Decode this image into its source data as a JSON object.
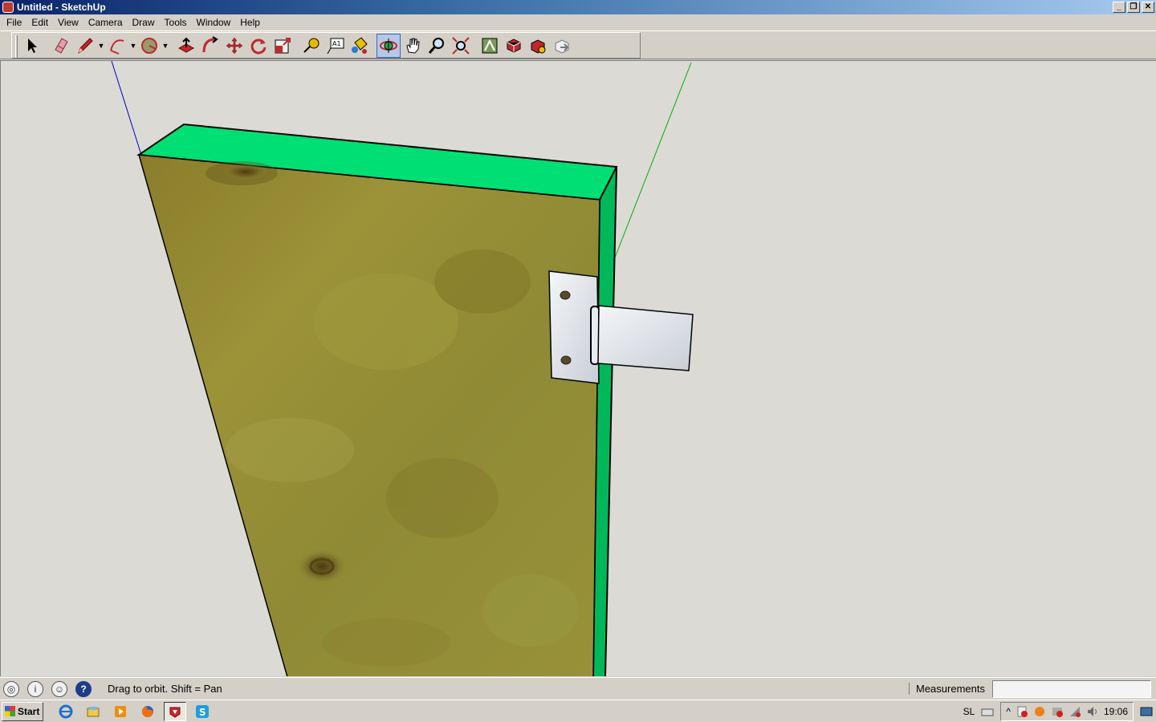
{
  "window": {
    "title": "Untitled - SketchUp",
    "minimize": "_",
    "restore": "❐",
    "close": "✕"
  },
  "menu": [
    "File",
    "Edit",
    "View",
    "Camera",
    "Draw",
    "Tools",
    "Window",
    "Help"
  ],
  "toolbar": {
    "tools": [
      "select",
      "eraser",
      "pencil",
      "arc",
      "circle",
      "push-pull",
      "follow-me",
      "move",
      "rotate",
      "scale",
      "tape-measure",
      "text",
      "paint-bucket",
      "orbit",
      "pan",
      "zoom",
      "zoom-extents",
      "previous-view",
      "outliner",
      "get-models",
      "share-model"
    ],
    "active_tool": "orbit",
    "text_tool_label": "A1"
  },
  "colors": {
    "face_top": "#00df74",
    "face_side": "#00b85a",
    "wood": "#8f8a33",
    "hinge": "#dfe3e8",
    "axis_blue": "#0000c8",
    "axis_green": "#00b000"
  },
  "status": {
    "message": "Drag to orbit.  Shift = Pan",
    "measurements_label": "Measurements",
    "measurements_value": "",
    "help_glyph": "?"
  },
  "taskbar": {
    "start_label": "Start",
    "apps": [
      "internet-explorer",
      "windows-explorer",
      "media-player",
      "firefox",
      "sketchup",
      "skype"
    ],
    "active_app": "sketchup",
    "language": "SL",
    "clock": "19:06"
  }
}
